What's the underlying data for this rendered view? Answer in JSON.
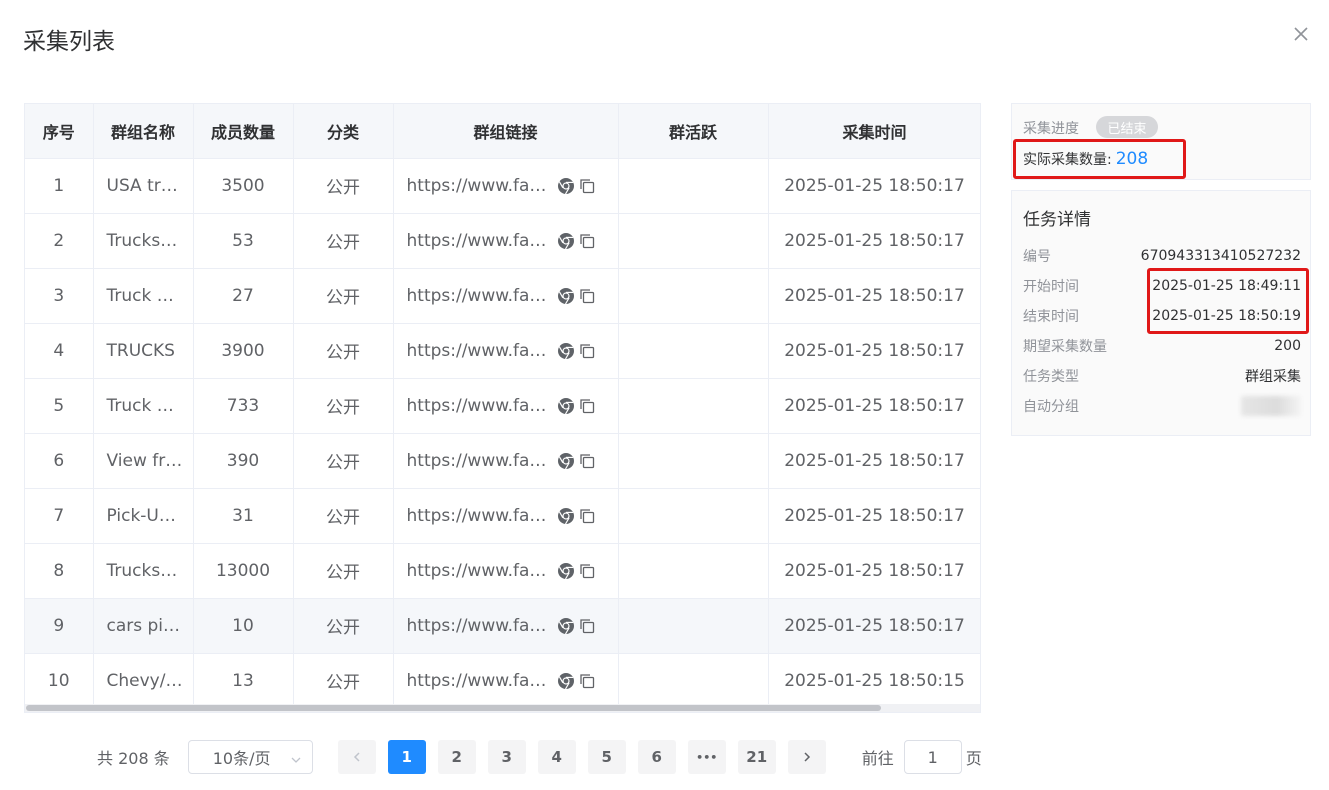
{
  "dialog": {
    "title": "采集列表"
  },
  "table": {
    "columns": [
      "序号",
      "群组名称",
      "成员数量",
      "分类",
      "群组链接",
      "群活跃",
      "采集时间"
    ],
    "rows": [
      {
        "index": "1",
        "name": "USA tr…",
        "members": "3500",
        "category": "公开",
        "link": "https://www.face…",
        "activity": "",
        "time": "2025-01-25 18:50:17"
      },
      {
        "index": "2",
        "name": "Trucks…",
        "members": "53",
        "category": "公开",
        "link": "https://www.face…",
        "activity": "",
        "time": "2025-01-25 18:50:17"
      },
      {
        "index": "3",
        "name": "Truck …",
        "members": "27",
        "category": "公开",
        "link": "https://www.face…",
        "activity": "",
        "time": "2025-01-25 18:50:17"
      },
      {
        "index": "4",
        "name": "TRUCKS",
        "members": "3900",
        "category": "公开",
        "link": "https://www.face…",
        "activity": "",
        "time": "2025-01-25 18:50:17"
      },
      {
        "index": "5",
        "name": "Truck …",
        "members": "733",
        "category": "公开",
        "link": "https://www.face…",
        "activity": "",
        "time": "2025-01-25 18:50:17"
      },
      {
        "index": "6",
        "name": "View fr…",
        "members": "390",
        "category": "公开",
        "link": "https://www.face…",
        "activity": "",
        "time": "2025-01-25 18:50:17"
      },
      {
        "index": "7",
        "name": "Pick-U…",
        "members": "31",
        "category": "公开",
        "link": "https://www.face…",
        "activity": "",
        "time": "2025-01-25 18:50:17"
      },
      {
        "index": "8",
        "name": "Trucks…",
        "members": "13000",
        "category": "公开",
        "link": "https://www.face…",
        "activity": "",
        "time": "2025-01-25 18:50:17"
      },
      {
        "index": "9",
        "name": "cars pi…",
        "members": "10",
        "category": "公开",
        "link": "https://www.face…",
        "activity": "",
        "time": "2025-01-25 18:50:17"
      },
      {
        "index": "10",
        "name": "Chevy/…",
        "members": "13",
        "category": "公开",
        "link": "https://www.face…",
        "activity": "",
        "time": "2025-01-25 18:50:15"
      }
    ]
  },
  "pagination": {
    "total": "共 208 条",
    "page_size": "10条/页",
    "pages": [
      "1",
      "2",
      "3",
      "4",
      "5",
      "6",
      "•••",
      "21"
    ],
    "current": "1",
    "goto_label": "前往",
    "goto_value": "1",
    "page_unit": "页"
  },
  "progress": {
    "label": "采集进度",
    "status": "已结束",
    "count_label": "实际采集数量:",
    "count_value": "208"
  },
  "task": {
    "title": "任务详情",
    "fields": [
      {
        "key": "编号",
        "value": "670943313410527232"
      },
      {
        "key": "开始时间",
        "value": "2025-01-25 18:49:11"
      },
      {
        "key": "结束时间",
        "value": "2025-01-25 18:50:19"
      },
      {
        "key": "期望采集数量",
        "value": "200"
      },
      {
        "key": "任务类型",
        "value": "群组采集"
      },
      {
        "key": "自动分组",
        "value": ""
      }
    ]
  },
  "colors": {
    "primary": "#1f8bff",
    "highlight_box": "#e01818"
  },
  "icons": {
    "close": "close-icon",
    "browser": "chrome-icon",
    "copy": "copy-icon"
  }
}
